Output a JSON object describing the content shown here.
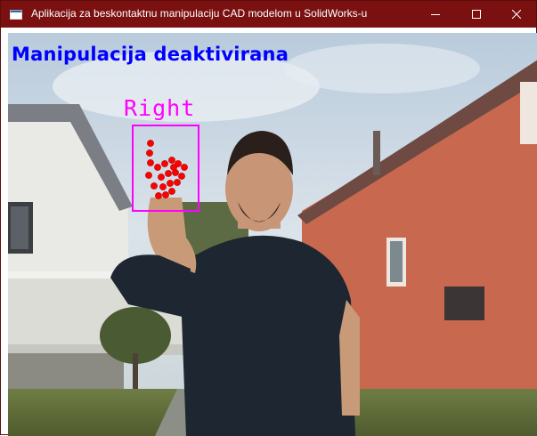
{
  "window": {
    "title": "Aplikacija za beskontaktnu manipulaciju CAD modelom u SolidWorks-u",
    "icon": "app-window-icon",
    "controls": [
      "minimize-icon",
      "maximize-icon",
      "close-icon"
    ]
  },
  "overlay": {
    "status_text": "Manipulacija deaktivirana",
    "status_color": "#0000ff",
    "hand_label": "Right",
    "hand_box_color": "#ff00ff",
    "landmark_color": "#ff0000"
  },
  "colors": {
    "titlebar": "#7a1010",
    "house_wall": "#c8684e",
    "sky": "#cfdbe6"
  }
}
